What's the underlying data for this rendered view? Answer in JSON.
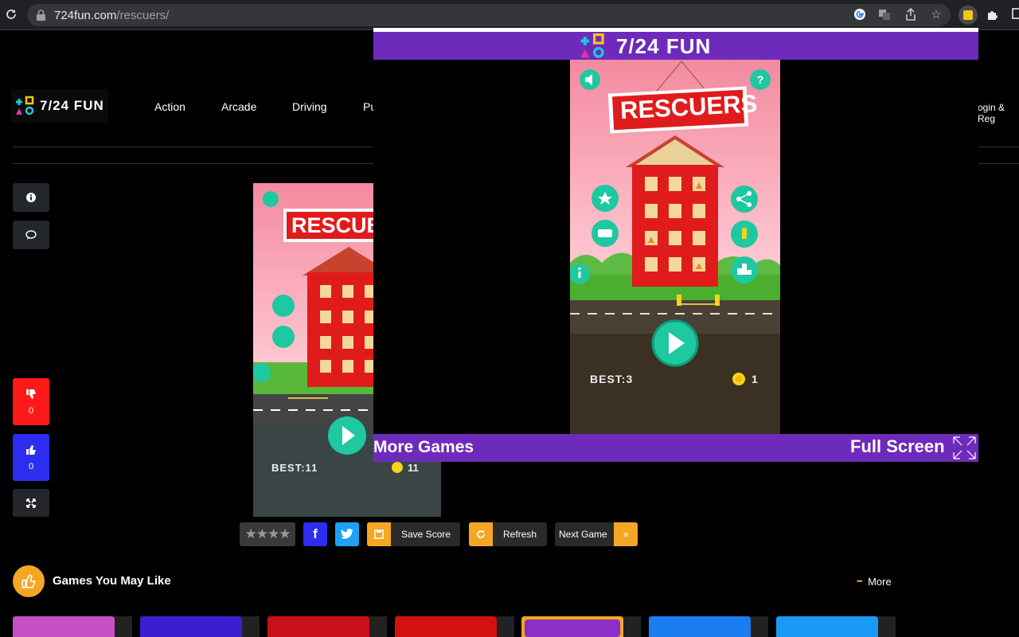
{
  "browser": {
    "url_host": "724fun.com",
    "url_path": "/rescuers/"
  },
  "site": {
    "logo_text": "7/24 FUN",
    "nav": [
      "Action",
      "Arcade",
      "Driving",
      "Pu"
    ],
    "login": "ogin & Reg"
  },
  "sidebar": {
    "dislike_count": "0",
    "like_count": "0"
  },
  "game": {
    "title": "RESCUERS",
    "embedded": {
      "title_partial": "RESCUE",
      "best": "BEST:11",
      "coins": "11"
    },
    "overlay": {
      "best": "BEST:3",
      "coins": "1"
    }
  },
  "actions": {
    "stars": "★★★★",
    "facebook": "f",
    "save_score": "Save Score",
    "refresh": "Refresh",
    "next_game": "Next Game",
    "next_arrow": "»"
  },
  "games_section": {
    "title": "Games You May Like",
    "more": "More",
    "more_dots": "•••"
  },
  "overlay": {
    "title": "7/24 FUN",
    "more_games": "More Games",
    "full_screen": "Full Screen"
  },
  "colors": {
    "purple": "#6e2bbb",
    "orange": "#f5a623",
    "red": "#ff1a1a",
    "blue": "#2d2df0",
    "teal": "#1ec8a0"
  },
  "icons": [
    "reload-icon",
    "lock-icon",
    "google-icon",
    "translate-icon",
    "share-icon",
    "star-icon",
    "extension-icon",
    "puzzle-icon",
    "info-icon",
    "comment-icon",
    "thumbs-down-icon",
    "thumbs-up-icon",
    "fullscreen-icon",
    "facebook-icon",
    "twitter-icon",
    "save-icon",
    "refresh-icon",
    "thumbs-up-circle-icon",
    "more-dots-icon",
    "sound-icon",
    "help-icon",
    "play-icon",
    "coin-icon"
  ]
}
